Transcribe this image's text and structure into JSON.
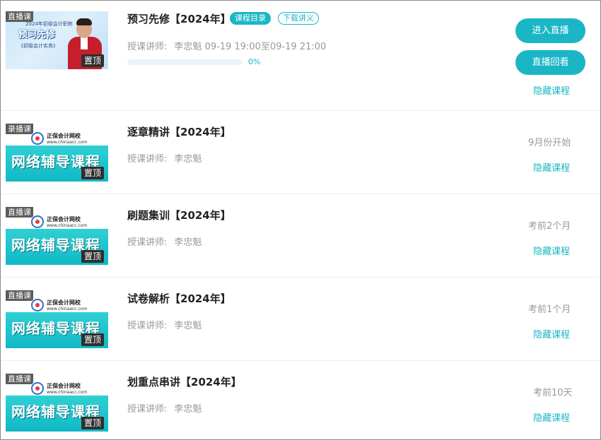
{
  "courses": [
    {
      "type_tag": "直播课",
      "pin": "置顶",
      "thumb_header": "2024年初级会计职称",
      "thumb_big": "预习先修",
      "thumb_sub": "《初级会计实务》",
      "title": "预习先修【2024年】",
      "chips": [
        "课程目录",
        "下载讲义"
      ],
      "teacher_label": "授课讲师:",
      "teacher_name": "李忠魁",
      "schedule": "09-19 19:00至09-19 21:00",
      "progress": 0,
      "progress_text": "0%",
      "buttons": [
        "进入直播",
        "直播回看"
      ],
      "hide_label": "隐藏课程"
    },
    {
      "type_tag": "录播课",
      "pin": "置顶",
      "brand": "正保会计网校",
      "url": "www.chinaacc.com",
      "thumb_big": "网络辅导课程",
      "title": "逐章精讲【2024年】",
      "teacher_label": "授课讲师:",
      "teacher_name": "李忠魁",
      "status": "9月份开始",
      "hide_label": "隐藏课程"
    },
    {
      "type_tag": "直播课",
      "pin": "置顶",
      "brand": "正保会计网校",
      "url": "www.chinaacc.com",
      "thumb_big": "网络辅导课程",
      "title": "刷题集训【2024年】",
      "teacher_label": "授课讲师:",
      "teacher_name": "李忠魁",
      "status": "考前2个月",
      "hide_label": "隐藏课程"
    },
    {
      "type_tag": "直播课",
      "pin": "置顶",
      "brand": "正保会计网校",
      "url": "www.chinaacc.com",
      "thumb_big": "网络辅导课程",
      "title": "试卷解析【2024年】",
      "teacher_label": "授课讲师:",
      "teacher_name": "李忠魁",
      "status": "考前1个月",
      "hide_label": "隐藏课程"
    },
    {
      "type_tag": "直播课",
      "pin": "置顶",
      "brand": "正保会计网校",
      "url": "www.chinaacc.com",
      "thumb_big": "网络辅导课程",
      "title": "划重点串讲【2024年】",
      "teacher_label": "授课讲师:",
      "teacher_name": "李忠魁",
      "status": "考前10天",
      "hide_label": "隐藏课程"
    }
  ],
  "colors": {
    "accent": "#1bb6c5",
    "muted_text": "#999999",
    "title_text": "#222222",
    "tag_bg": "#5b5b5b"
  }
}
